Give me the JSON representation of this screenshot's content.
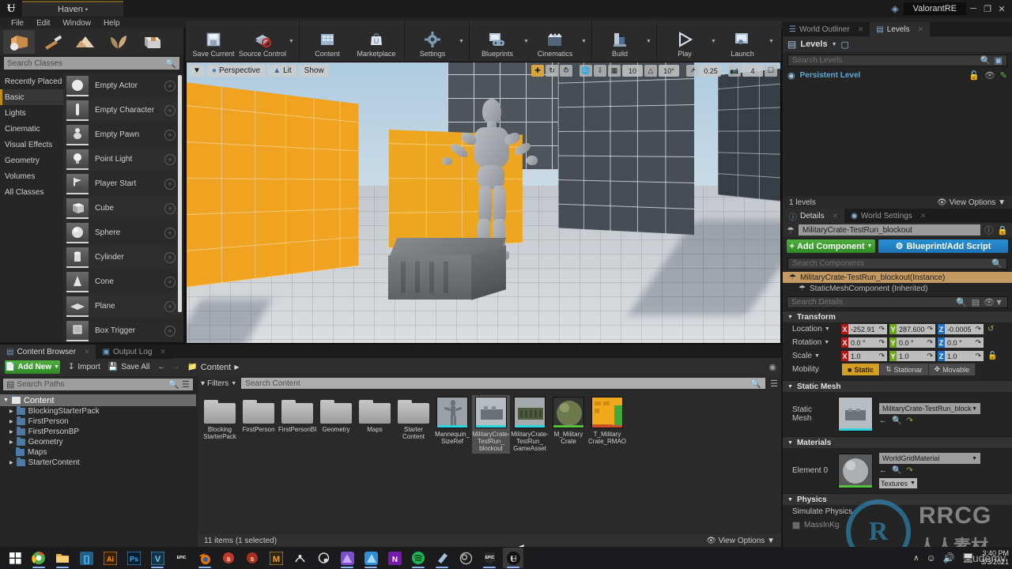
{
  "titlebar": {
    "project_tab": "Haven",
    "project_tab_marker": "•",
    "window_title": "ValorantRE",
    "minimize": "─",
    "maximize": "❐",
    "close": "✕"
  },
  "menubar": {
    "items": [
      "File",
      "Edit",
      "Window",
      "Help"
    ]
  },
  "modes": {
    "items": [
      {
        "name": "place-mode",
        "icon": "cube-sphere-icon",
        "active": true
      },
      {
        "name": "paint-mode",
        "icon": "brush-icon",
        "active": false
      },
      {
        "name": "landscape-mode",
        "icon": "mountain-icon",
        "active": false
      },
      {
        "name": "foliage-mode",
        "icon": "leaf-icon",
        "active": false
      },
      {
        "name": "geometry-edit-mode",
        "icon": "box-edit-icon",
        "active": false
      }
    ]
  },
  "toolbar": {
    "groups": [
      {
        "items": [
          {
            "label": "Save Current",
            "icon": "save-icon",
            "caret": false
          },
          {
            "label": "Source Control",
            "icon": "source-control-icon",
            "caret": true
          }
        ]
      },
      {
        "items": [
          {
            "label": "Content",
            "icon": "content-icon",
            "caret": false
          },
          {
            "label": "Marketplace",
            "icon": "marketplace-icon",
            "caret": false
          }
        ]
      },
      {
        "items": [
          {
            "label": "Settings",
            "icon": "settings-icon",
            "caret": true
          }
        ]
      },
      {
        "items": [
          {
            "label": "Blueprints",
            "icon": "blueprints-icon",
            "caret": true
          },
          {
            "label": "Cinematics",
            "icon": "cinematics-icon",
            "caret": true
          }
        ]
      },
      {
        "items": [
          {
            "label": "Build",
            "icon": "build-icon",
            "caret": true
          }
        ]
      },
      {
        "items": [
          {
            "label": "Play",
            "icon": "play-icon",
            "caret": true
          },
          {
            "label": "Launch",
            "icon": "launch-icon",
            "caret": true
          }
        ]
      }
    ]
  },
  "place_actors": {
    "search_placeholder": "Search Classes",
    "categories": [
      {
        "label": "Recently Placed",
        "active": false
      },
      {
        "label": "Basic",
        "active": true
      },
      {
        "label": "Lights",
        "active": false
      },
      {
        "label": "Cinematic",
        "active": false
      },
      {
        "label": "Visual Effects",
        "active": false
      },
      {
        "label": "Geometry",
        "active": false
      },
      {
        "label": "Volumes",
        "active": false
      },
      {
        "label": "All Classes",
        "active": false
      }
    ],
    "items": [
      {
        "label": "Empty Actor",
        "icon": "sphere-icon"
      },
      {
        "label": "Empty Character",
        "icon": "character-icon"
      },
      {
        "label": "Empty Pawn",
        "icon": "pawn-icon"
      },
      {
        "label": "Point Light",
        "icon": "bulb-icon"
      },
      {
        "label": "Player Start",
        "icon": "player-start-icon"
      },
      {
        "label": "Cube",
        "icon": "cube-icon"
      },
      {
        "label": "Sphere",
        "icon": "sphere-icon"
      },
      {
        "label": "Cylinder",
        "icon": "cylinder-icon"
      },
      {
        "label": "Cone",
        "icon": "cone-icon"
      },
      {
        "label": "Plane",
        "icon": "plane-icon"
      },
      {
        "label": "Box Trigger",
        "icon": "box-trigger-icon"
      }
    ]
  },
  "viewport": {
    "camera_mode": "Perspective",
    "view_mode": "Lit",
    "show_menu": "Show",
    "grid_snap_value": "10",
    "rotation_snap_value": "10°",
    "scale_snap_value": "0.25",
    "camera_speed_value": "4",
    "transform_tools": [
      "translate-icon",
      "rotate-icon",
      "scale-icon"
    ],
    "active_transform_tool": "translate-icon",
    "coordinate_system": "world-icon",
    "surface_snap": "surface-snap-icon",
    "grid_toggle": "grid-icon"
  },
  "outliner": {
    "tabs": [
      {
        "label": "World Outliner",
        "icon": "outliner-icon",
        "active": false
      },
      {
        "label": "Levels",
        "icon": "levels-icon",
        "active": true
      }
    ],
    "panel_title": "Levels",
    "search_placeholder": "Search Levels",
    "rows": [
      {
        "name": "Persistent Level",
        "lock": "lock-icon",
        "visible": "eye-icon",
        "edit": "pencil-icon"
      }
    ],
    "footer_count": "1 levels",
    "footer_view_options": "View Options"
  },
  "details": {
    "tabs": [
      {
        "label": "Details",
        "icon": "details-icon",
        "active": true
      },
      {
        "label": "World Settings",
        "icon": "world-settings-icon",
        "active": false
      }
    ],
    "actor_name": "MilitaryCrate-TestRun_blockout",
    "add_component_label": "Add Component",
    "blueprint_label": "Blueprint/Add Script",
    "components_search_placeholder": "Search Components",
    "components": [
      {
        "label": "MilitaryCrate-TestRun_blockout(Instance)",
        "selected": true
      },
      {
        "label": "StaticMeshComponent (Inherited)",
        "selected": false
      }
    ],
    "details_search_placeholder": "Search Details",
    "sections": {
      "transform": {
        "title": "Transform",
        "location_label": "Location",
        "location": {
          "x": "-252.91",
          "y": "287.600",
          "z": "-0.0005"
        },
        "rotation_label": "Rotation",
        "rotation": {
          "x": "0.0 °",
          "y": "0.0 °",
          "z": "0.0 °"
        },
        "scale_label": "Scale",
        "scale": {
          "x": "1.0",
          "y": "1.0",
          "z": "1.0"
        },
        "mobility_label": "Mobility",
        "mobility_options": [
          "Static",
          "Stationar",
          "Movable"
        ],
        "mobility_selected": "Static"
      },
      "static_mesh": {
        "title": "Static Mesh",
        "row_label": "Static Mesh",
        "value": "MilitaryCrate-TestRun_blockout"
      },
      "materials": {
        "title": "Materials",
        "row_label": "Element 0",
        "value": "WorldGridMaterial",
        "textures_label": "Textures"
      },
      "physics": {
        "title": "Physics",
        "simulate_physics_label": "Simulate Physics",
        "mass_label": "MassInKg"
      }
    }
  },
  "content_browser": {
    "tabs": [
      {
        "label": "Content Browser",
        "icon": "content-browser-icon",
        "active": true
      },
      {
        "label": "Output Log",
        "icon": "output-log-icon",
        "active": false
      }
    ],
    "add_new_label": "Add New",
    "import_label": "Import",
    "save_all_label": "Save All",
    "breadcrumb": "Content",
    "paths_search_placeholder": "Search Paths",
    "content_search_placeholder": "Search Content",
    "filters_label": "Filters",
    "tree": {
      "root": "Content",
      "children": [
        "BlockingStarterPack",
        "FirstPerson",
        "FirstPersonBP",
        "Geometry",
        "Maps",
        "StarterContent"
      ]
    },
    "assets": [
      {
        "name": "Blocking StarterPack",
        "type": "folder",
        "selected": false
      },
      {
        "name": "FirstPerson",
        "type": "folder",
        "selected": false
      },
      {
        "name": "FirstPersonBP",
        "type": "folder",
        "selected": false
      },
      {
        "name": "Geometry",
        "type": "folder",
        "selected": false
      },
      {
        "name": "Maps",
        "type": "folder",
        "selected": false
      },
      {
        "name": "Starter Content",
        "type": "folder",
        "selected": false
      },
      {
        "name": "Mannequin_ SizeRef",
        "type": "mesh",
        "selected": false,
        "bar_color": "#2ad4e0"
      },
      {
        "name": "MilitaryCrate- TestRun_ blockout",
        "type": "mesh",
        "selected": true,
        "bar_color": "#2ad4e0"
      },
      {
        "name": "MilitaryCrate- TestRun_ GameAsset",
        "type": "mesh",
        "selected": false,
        "bar_color": "#2ad4e0"
      },
      {
        "name": "M_Military Crate",
        "type": "material",
        "selected": false,
        "bar_color": "#54c23a"
      },
      {
        "name": "T_Military Crate_RMAO",
        "type": "texture",
        "selected": false,
        "bar_color": "#d04a2a"
      }
    ],
    "status_count": "11 items (1 selected)",
    "view_options": "View Options"
  },
  "taskbar": {
    "start_icon": "windows-icon",
    "apps": [
      {
        "name": "chrome",
        "glyph": "",
        "color": "#2f9e4f",
        "running": true
      },
      {
        "name": "file-explorer",
        "glyph": "",
        "color": "#e8b23a",
        "running": true
      },
      {
        "name": "store",
        "glyph": "[]",
        "color": "#2b8fd8",
        "running": false
      },
      {
        "name": "illustrator",
        "glyph": "Ai",
        "color": "#ff9a00",
        "running": false
      },
      {
        "name": "photoshop",
        "glyph": "Ps",
        "color": "#31a8ff",
        "running": false
      },
      {
        "name": "vegas",
        "glyph": "V",
        "color": "#35b0e8",
        "running": true
      },
      {
        "name": "epic-games",
        "glyph": "EPIC",
        "color": "#f2f2f2",
        "running": false
      },
      {
        "name": "blender",
        "glyph": "",
        "color": "#ea7600",
        "running": true
      },
      {
        "name": "substance-painter",
        "glyph": "S",
        "color": "#d4481f",
        "running": false
      },
      {
        "name": "substance-designer",
        "glyph": "S",
        "color": "#c8371c",
        "running": false
      },
      {
        "name": "marmoset",
        "glyph": "M",
        "color": "#e8a32a",
        "running": false
      },
      {
        "name": "quixel-bridge",
        "glyph": "",
        "color": "#dcdcdc",
        "running": false
      },
      {
        "name": "quixel-mixer",
        "glyph": "",
        "color": "#d9d9d9",
        "running": false
      },
      {
        "name": "affinity-photo",
        "glyph": "",
        "color": "#8b5ad8",
        "running": true
      },
      {
        "name": "affinity-designer",
        "glyph": "",
        "color": "#2e8fd8",
        "running": true
      },
      {
        "name": "onenote",
        "glyph": "N",
        "color": "#7719aa",
        "running": false
      },
      {
        "name": "spotify",
        "glyph": "",
        "color": "#1db954",
        "running": true
      },
      {
        "name": "notes",
        "glyph": "",
        "color": "#9cc2e0",
        "running": true
      },
      {
        "name": "obs-studio",
        "glyph": "",
        "color": "#b5b5b5",
        "running": false
      },
      {
        "name": "epic-launcher",
        "glyph": "EPIC",
        "color": "#f2f2f2",
        "running": true
      },
      {
        "name": "unreal-engine",
        "glyph": "Ʉ",
        "color": "#e0e0e0",
        "running": true
      }
    ],
    "tray": {
      "chevron": "∧",
      "discord": "discord-icon",
      "volume": "volume-icon",
      "network": "network-icon",
      "time": "3:40 PM",
      "date": "3/3/2021"
    },
    "watermark_text": "udemy"
  },
  "watermark": {
    "logo_letter": "R",
    "line1": "RRCG",
    "line2": "人人素材"
  }
}
